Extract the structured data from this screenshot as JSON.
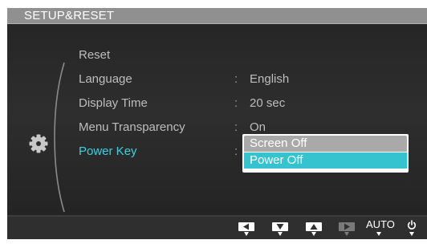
{
  "title": "SETUP&RESET",
  "menu": {
    "items": [
      {
        "label": "Reset",
        "value": null
      },
      {
        "label": "Language",
        "value": "English"
      },
      {
        "label": "Display Time",
        "value": "20 sec"
      },
      {
        "label": "Menu Transparency",
        "value": "On"
      },
      {
        "label": "Power Key",
        "value": null
      }
    ],
    "separator": ":",
    "selected_index": 4,
    "selected_color": "#3bd1e0"
  },
  "dropdown": {
    "options": [
      "Screen Off",
      "Power Off"
    ],
    "highlighted_index": 1,
    "highlight_color": "#35c4cf"
  },
  "side_icon": "gear-icon",
  "bottom_bar": {
    "buttons": [
      {
        "icon": "left-arrow-icon",
        "enabled": true
      },
      {
        "icon": "down-arrow-icon",
        "enabled": true
      },
      {
        "icon": "up-arrow-icon",
        "enabled": true
      },
      {
        "icon": "right-arrow-icon",
        "enabled": false
      }
    ],
    "auto_label": "AUTO",
    "power_icon": "power-icon"
  }
}
